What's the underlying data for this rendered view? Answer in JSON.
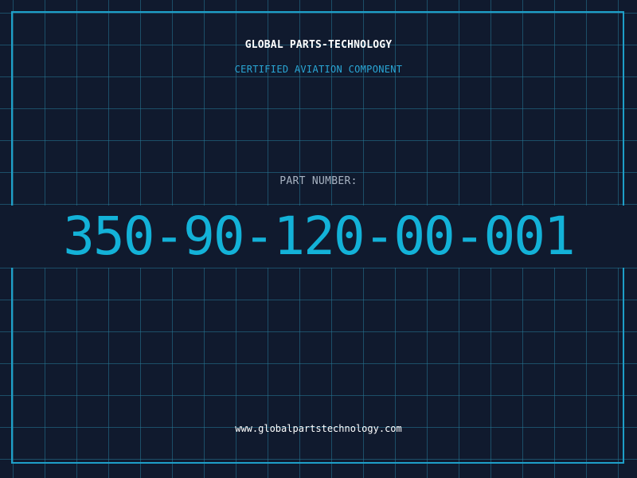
{
  "header": {
    "company": "GLOBAL PARTS-TECHNOLOGY",
    "subtitle": "CERTIFIED AVIATION COMPONENT"
  },
  "part": {
    "label": "PART NUMBER:",
    "number": "350-90-120-00-001"
  },
  "footer": {
    "website": "www.globalpartstechnology.com"
  },
  "colors": {
    "background": "#101a2e",
    "grid": "#26789a",
    "accent": "#13b2d8",
    "frame": "#1e9fc8",
    "text": "#ffffff",
    "muted": "#a8b3c2"
  }
}
